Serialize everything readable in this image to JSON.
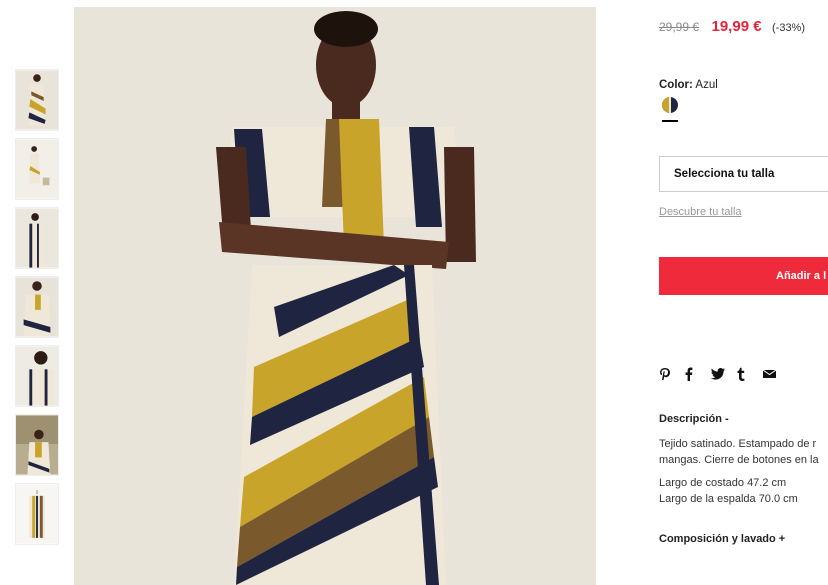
{
  "gallery": {
    "thumbnails": [
      {
        "alt": "Vestido vista frontal completa"
      },
      {
        "alt": "Vestido vista de lejos"
      },
      {
        "alt": "Vestido vista trasera"
      },
      {
        "alt": "Vestido detalle"
      },
      {
        "alt": "Vestido detalle espalda"
      },
      {
        "alt": "Vestido look completo"
      },
      {
        "alt": "Vestido en percha"
      }
    ]
  },
  "product": {
    "old_price": "29,99 €",
    "new_price": "19,99 €",
    "discount": "(-33%)",
    "color_label": "Color:",
    "color_value": "Azul",
    "size_placeholder": "Selecciona tu talla",
    "size_guide_link": "Descubre tu talla",
    "add_button": "Añadir a l",
    "share_icons": [
      "pinterest-icon",
      "facebook-icon",
      "twitter-icon",
      "tumblr-icon",
      "email-icon"
    ],
    "description_title": "Descripción -",
    "description_text": "Tejido satinado. Estampado de r mangas. Cierre de botones en la",
    "measures": [
      "Largo de costado 47.2 cm",
      "Largo de la espalda 70.0 cm"
    ],
    "composition_title": "Composición y lavado +"
  },
  "colors": {
    "accent": "#ef2b3b",
    "sale_price": "#e0253a",
    "dress_yellow": "#c9a42a",
    "dress_navy": "#1f2540",
    "dress_brown": "#7a5a2c",
    "dress_cream": "#efe7d8"
  }
}
